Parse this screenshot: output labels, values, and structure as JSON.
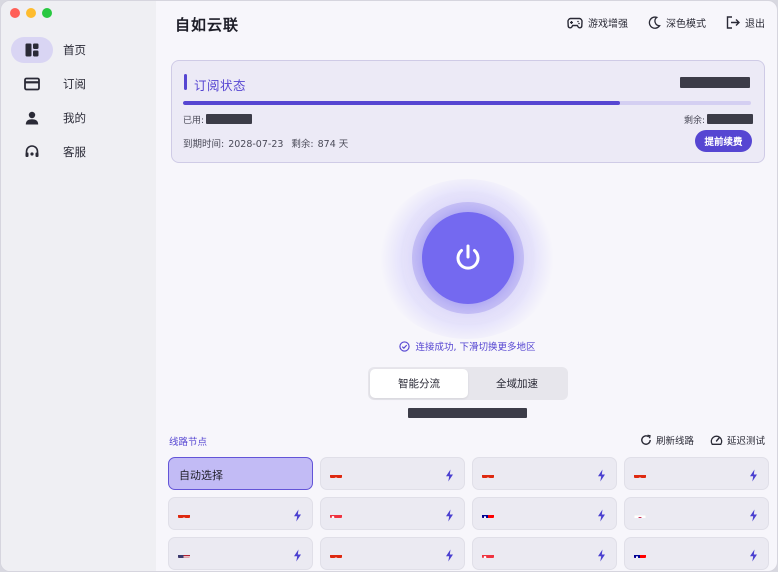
{
  "app": {
    "title": "自如云联"
  },
  "sidebar": {
    "items": [
      {
        "label": "首页",
        "icon": "dashboard-icon",
        "active": true
      },
      {
        "label": "订阅",
        "icon": "card-icon",
        "active": false
      },
      {
        "label": "我的",
        "icon": "user-icon",
        "active": false
      },
      {
        "label": "客服",
        "icon": "headset-icon",
        "active": false
      }
    ]
  },
  "header": {
    "game_boost": "游戏增强",
    "dark_mode": "深色模式",
    "logout": "退出"
  },
  "subscription": {
    "title": "订阅状态",
    "used_label": "已用:",
    "remaining_label": "剩余:",
    "expiry_label": "到期时间:",
    "expiry_date": "2028-07-23",
    "days_left_label": "剩余:",
    "days_left": "874 天",
    "progress_fraction": 0.77,
    "renew_button": "提前续费"
  },
  "connection": {
    "status_text": "连接成功, 下滑切换更多地区"
  },
  "mode": {
    "options": [
      "智能分流",
      "全域加速"
    ],
    "selected": "智能分流"
  },
  "nodes": {
    "title": "线路节点",
    "refresh": "刷新线路",
    "latency_test": "延迟测试",
    "auto_label": "自动选择",
    "flags": [
      "HK",
      "HK",
      "HK",
      "HK",
      "SG",
      "TW",
      "JP",
      "US",
      "HK",
      "SG",
      "TW"
    ]
  },
  "colors": {
    "accent": "#5646d2",
    "power": "#7469f0",
    "active_node": "#c2bbf5"
  }
}
